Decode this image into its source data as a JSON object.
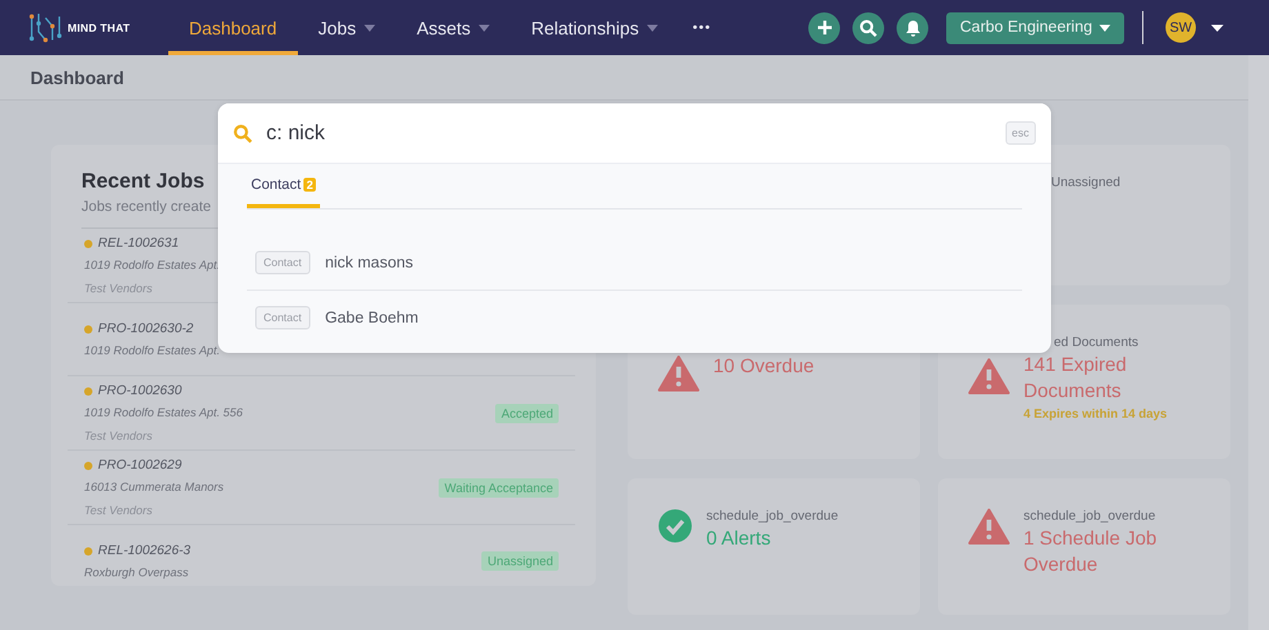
{
  "nav": {
    "logo": "MIND THAT",
    "items": [
      {
        "label": "Dashboard",
        "selected": true,
        "dropdown": false
      },
      {
        "label": "Jobs",
        "selected": false,
        "dropdown": true
      },
      {
        "label": "Assets",
        "selected": false,
        "dropdown": true
      },
      {
        "label": "Relationships",
        "selected": false,
        "dropdown": true
      }
    ],
    "more": "•••",
    "company": "Carbo Engineering",
    "avatar": "SW"
  },
  "breadcrumb": "Dashboard",
  "recent_jobs": {
    "title": "Recent Jobs",
    "subtitle": "Jobs recently create",
    "jobs": [
      {
        "id": "REL-1002631",
        "address": "1019 Rodolfo Estates Apt.",
        "vendor": "Test Vendors"
      },
      {
        "id": "PRO-1002630-2",
        "address": "1019 Rodolfo Estates Apt."
      },
      {
        "id": "PRO-1002630",
        "address": "1019 Rodolfo Estates Apt. 556",
        "vendor": "Test Vendors",
        "status": "Accepted"
      },
      {
        "id": "PRO-1002629",
        "address": "16013 Cummerata Manors",
        "vendor": "Test Vendors",
        "status": "Waiting Acceptance"
      },
      {
        "id": "REL-1002626-3",
        "address": "Roxburgh Overpass",
        "status": "Unassigned"
      }
    ]
  },
  "alerts": [
    {
      "kind": "none",
      "label": "Unassigned"
    },
    {
      "kind": "warning",
      "value": "10 Overdue"
    },
    {
      "kind": "warning",
      "label": "ed Documents",
      "value": "141 Expired Documents",
      "note": "4 Expires within 14 days"
    },
    {
      "kind": "ok",
      "label": "schedule_job_overdue",
      "value": "0 Alerts"
    },
    {
      "kind": "warning",
      "label": "schedule_job_overdue",
      "value": "1 Schedule Job Overdue"
    }
  ],
  "search": {
    "query": "c: nick",
    "esc": "esc",
    "tabs": [
      {
        "label": "Contact",
        "count": "2",
        "selected": true
      }
    ],
    "results": [
      {
        "type": "Contact",
        "name": "nick masons"
      },
      {
        "type": "Contact",
        "name": "Gabe Boehm"
      }
    ]
  }
}
